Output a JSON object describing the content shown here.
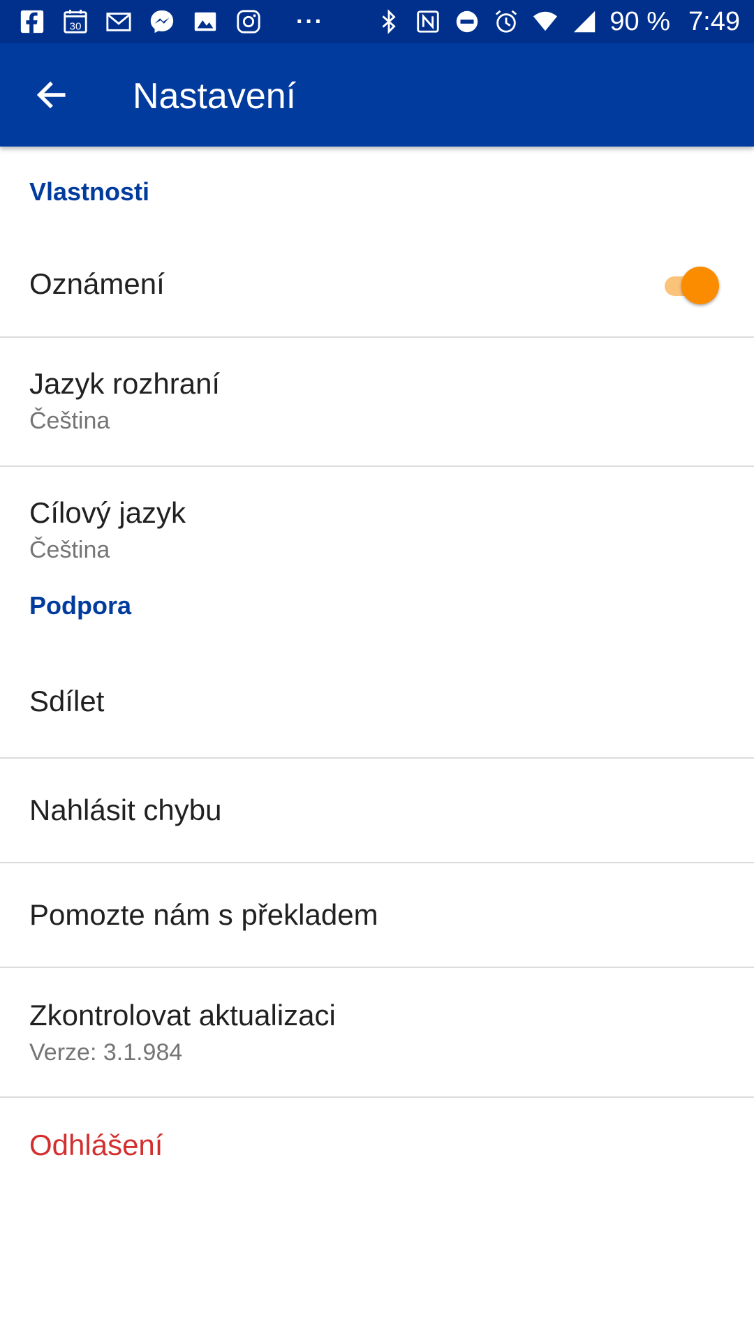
{
  "status_bar": {
    "left_icons": [
      "facebook-icon",
      "calendar-icon",
      "gmail-icon",
      "messenger-icon",
      "gallery-icon",
      "instagram-icon"
    ],
    "calendar_day": "30",
    "overflow": "···",
    "right_icons": [
      "bluetooth-icon",
      "nfc-icon",
      "do-not-disturb-icon",
      "alarm-icon",
      "wifi-icon",
      "signal-icon"
    ],
    "battery": "90 %",
    "time": "7:49"
  },
  "app_bar": {
    "title": "Nastavení",
    "back_icon": "arrow-back-icon"
  },
  "sections": {
    "properties": {
      "header": "Vlastnosti",
      "notifications": {
        "label": "Oznámení",
        "enabled": true
      },
      "ui_language": {
        "label": "Jazyk rozhraní",
        "value": "Čeština"
      },
      "target_language": {
        "label": "Cílový jazyk",
        "value": "Čeština"
      }
    },
    "support": {
      "header": "Podpora",
      "share": {
        "label": "Sdílet"
      },
      "report_bug": {
        "label": "Nahlásit chybu"
      },
      "help_translate": {
        "label": "Pomozte nám s překladem"
      },
      "check_update": {
        "label": "Zkontrolovat aktualizaci",
        "value": "Verze: 3.1.984"
      },
      "logout": {
        "label": "Odhlášení"
      }
    }
  },
  "colors": {
    "status_bar": "#01308c",
    "app_bar": "#023b9e",
    "section_header": "#023b9e",
    "toggle_thumb": "#fb8c00",
    "toggle_track": "#fbc37a",
    "logout": "#d32f2f"
  }
}
